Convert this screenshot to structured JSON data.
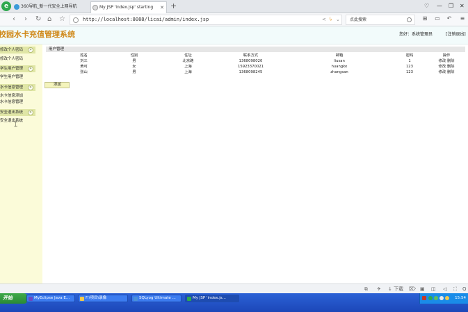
{
  "browser": {
    "logo_text": "e",
    "tabs": [
      {
        "label": "360导航_新一代安全上网导航"
      },
      {
        "label": "My JSP 'index.jsp' starting"
      }
    ],
    "new_tab": "+",
    "window_controls": {
      "minimize": "—",
      "restore": "❐",
      "close": "✕"
    },
    "url": "http://localhost:8088/licai/admin/index.jsp",
    "search_text": "点此搜索"
  },
  "app": {
    "title": "校园水卡充值管理系统",
    "welcome": "您好：系统管理员",
    "logout": "[注销退出]"
  },
  "sidebar": {
    "sections": [
      {
        "header": "修改个人密码",
        "items": [
          "修改个人密码"
        ]
      },
      {
        "header": "学生用户管理",
        "items": [
          "学生用户管理"
        ]
      },
      {
        "header": "水卡信息管理",
        "items": [
          "水卡信息添加",
          "水卡信息管理"
        ]
      },
      {
        "header": "安全退出系统",
        "items": [
          "安全退出系统"
        ]
      }
    ],
    "toggle_symbol": "»"
  },
  "content": {
    "title": "用户管理",
    "columns": [
      "姓名",
      "性别",
      "住址",
      "联系方式",
      "邮箱",
      "密码",
      "操作"
    ],
    "rows": [
      {
        "name": "刘三",
        "gender": "男",
        "address": "北京路",
        "phone": "1368098020",
        "email": "liusan",
        "password": "1",
        "edit": "修改",
        "delete": "删除"
      },
      {
        "name": "黄可",
        "gender": "女",
        "address": "上海",
        "phone": "15923370021",
        "email": "huangke",
        "password": "123",
        "edit": "修改",
        "delete": "删除"
      },
      {
        "name": "张山",
        "gender": "男",
        "address": "上海",
        "phone": "1368098245",
        "email": "zhangsan",
        "password": "123",
        "edit": "修改",
        "delete": "删除"
      }
    ],
    "add_button": "添加"
  },
  "statusbar": {
    "download_label": "下载"
  },
  "taskbar": {
    "start_label": "开始",
    "items": [
      {
        "label": "MyEclipse Java E...",
        "color": "#6b4ac2"
      },
      {
        "label": "F:\\项目\\录像",
        "color": "#f2c94c"
      },
      {
        "label": "SQLyog Ultimate ...",
        "color": "#4a90d9"
      },
      {
        "label": "My JSP 'index.js...",
        "color": "#2fa84f"
      }
    ],
    "clock": "15:54"
  },
  "colors": {
    "title_orange": "#d08818",
    "sidebar_bg": "#fbfbd9",
    "section_header_bg": "#e0e6a6",
    "taskbar_blue": "#1c47b8"
  }
}
